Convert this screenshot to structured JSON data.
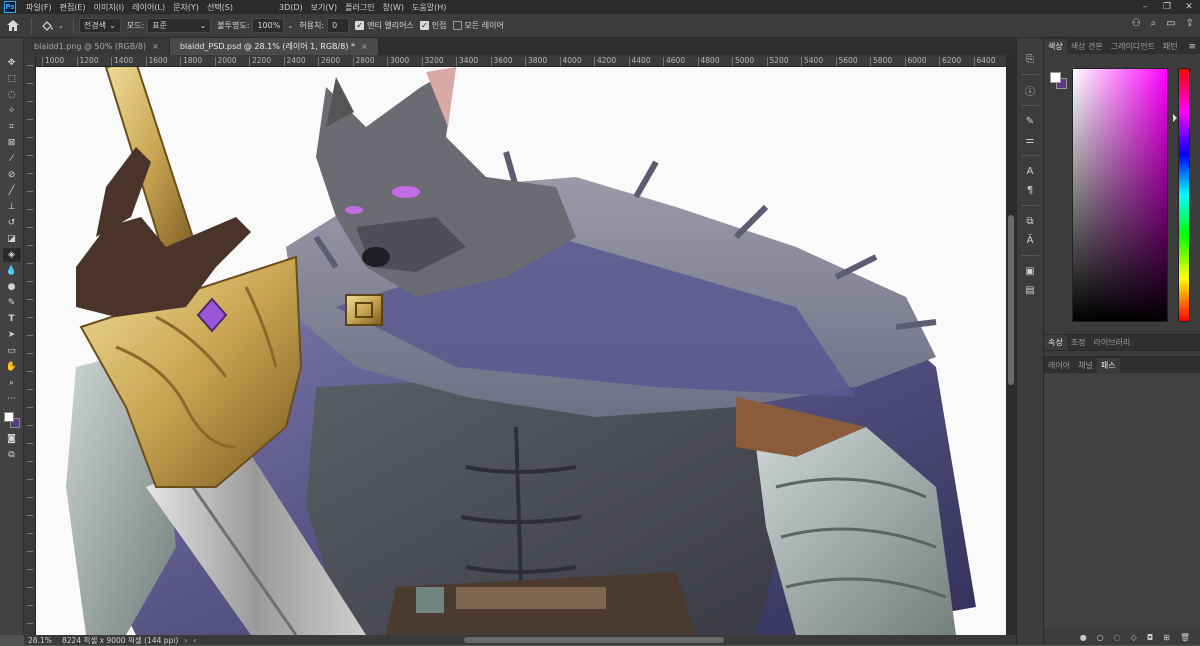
{
  "menubar": {
    "logo": "Ps",
    "items": [
      "파일(F)",
      "편집(E)",
      "이미지(I)",
      "레이어(L)",
      "문자(Y)",
      "선택(S)"
    ],
    "items_right": [
      "3D(D)",
      "보기(V)",
      "플러그인",
      "창(W)",
      "도움말(H)"
    ]
  },
  "options": {
    "fill_source": "전경색",
    "mode_label": "모드:",
    "mode_value": "표준",
    "opacity_label": "불투명도:",
    "opacity_value": "100%",
    "tolerance_label": "허용치:",
    "tolerance_value": "0",
    "antialias_label": "앤티 앨리어스",
    "antialias_checked": true,
    "contiguous_label": "인접",
    "contiguous_checked": true,
    "all_layers_label": "모든 레이어",
    "all_layers_checked": false
  },
  "tabs": [
    {
      "label": "blaidd1.png @ 50% (RGB/8)",
      "active": false
    },
    {
      "label": "blaidd_PSD.psd @ 28.1% (레이어 1, RGB/8) *",
      "active": true
    }
  ],
  "ruler_top": [
    "1000",
    "1200",
    "1400",
    "1600",
    "1800",
    "2000",
    "2200",
    "2400",
    "2600",
    "2800",
    "3000",
    "3200",
    "3400",
    "3600",
    "3800",
    "4000",
    "4200",
    "4400",
    "4600",
    "4800",
    "5000",
    "5200",
    "5400",
    "5600",
    "5800",
    "6000",
    "6200",
    "6400"
  ],
  "panels": {
    "color_tabs": [
      "색상",
      "색상 견본",
      "그레이디언트",
      "패턴"
    ],
    "adjust_tabs": [
      "속성",
      "조정",
      "라이브러리"
    ],
    "layer_tabs": [
      "레이어",
      "채널",
      "패스"
    ],
    "foreground_color": "#ffffff",
    "background_color": "#5b3a8b"
  },
  "status": {
    "zoom": "28.1%",
    "doc_info": "8224 픽셀 x 9000 픽셀 (144 ppi)"
  }
}
